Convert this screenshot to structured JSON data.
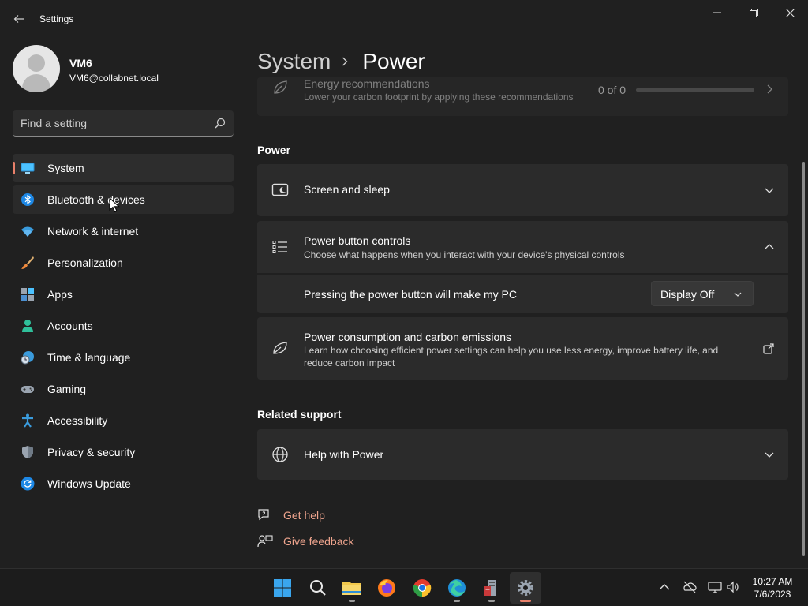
{
  "app": {
    "title": "Settings"
  },
  "profile": {
    "name": "VM6",
    "email": "VM6@collabnet.local"
  },
  "search": {
    "placeholder": "Find a setting"
  },
  "nav": {
    "items": [
      {
        "label": "System",
        "icon": "monitor-icon",
        "selected": true
      },
      {
        "label": "Bluetooth & devices",
        "icon": "bluetooth-icon"
      },
      {
        "label": "Network & internet",
        "icon": "wifi-icon"
      },
      {
        "label": "Personalization",
        "icon": "paintbrush-icon"
      },
      {
        "label": "Apps",
        "icon": "apps-grid-icon"
      },
      {
        "label": "Accounts",
        "icon": "person-icon"
      },
      {
        "label": "Time & language",
        "icon": "globe-clock-icon"
      },
      {
        "label": "Gaming",
        "icon": "gamepad-icon"
      },
      {
        "label": "Accessibility",
        "icon": "accessibility-icon"
      },
      {
        "label": "Privacy & security",
        "icon": "shield-icon"
      },
      {
        "label": "Windows Update",
        "icon": "refresh-icon"
      }
    ]
  },
  "breadcrumb": {
    "parent": "System",
    "current": "Power"
  },
  "energy": {
    "title": "Energy recommendations",
    "description": "Lower your carbon footprint by applying these recommendations",
    "count": "0 of 0",
    "progress": 0
  },
  "power_section": {
    "title": "Power"
  },
  "screen_sleep": {
    "title": "Screen and sleep"
  },
  "power_button": {
    "title": "Power button controls",
    "description": "Choose what happens when you interact with your device's physical controls",
    "row_label": "Pressing the power button will make my PC",
    "dropdown_value": "Display Off"
  },
  "carbon": {
    "title": "Power consumption and carbon emissions",
    "description_line1": "Learn how choosing efficient power settings can help you use less energy, improve battery life, and",
    "description_line2": "reduce carbon impact"
  },
  "related": {
    "title": "Related support",
    "help_power": "Help with Power"
  },
  "links": {
    "get_help": "Get help",
    "give_feedback": "Give feedback"
  },
  "taskbar": {
    "time": "10:27 AM",
    "date": "7/6/2023",
    "apps": [
      "start-icon",
      "search-icon",
      "file-explorer-icon",
      "firefox-icon",
      "chrome-icon",
      "edge-icon",
      "server-manager-icon",
      "settings-gear-icon"
    ]
  },
  "colors": {
    "accent": "#e8806a",
    "background": "#202020",
    "card": "#2b2b2b",
    "link": "#f0a58e"
  }
}
